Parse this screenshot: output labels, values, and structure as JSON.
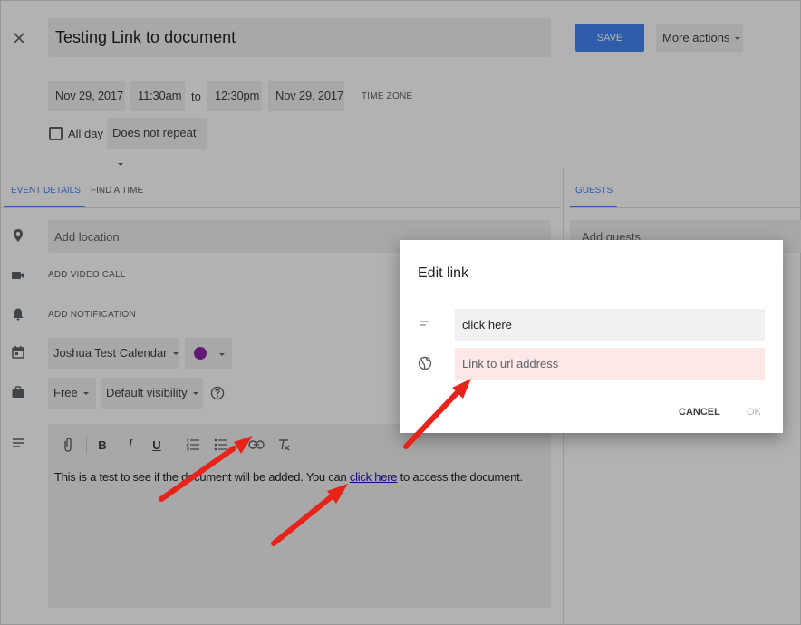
{
  "header": {
    "title": "Testing Link to document",
    "save_label": "SAVE",
    "more_actions_label": "More actions"
  },
  "schedule": {
    "start_date": "Nov 29, 2017",
    "start_time": "11:30am",
    "to_label": "to",
    "end_time": "12:30pm",
    "end_date": "Nov 29, 2017",
    "time_zone_label": "TIME ZONE",
    "all_day_label": "All day",
    "repeat_value": "Does not repeat"
  },
  "tabs": {
    "event_details": "EVENT DETAILS",
    "find_a_time": "FIND A TIME",
    "guests": "GUESTS"
  },
  "details": {
    "location_placeholder": "Add location",
    "video_call_label": "ADD VIDEO CALL",
    "notification_label": "ADD NOTIFICATION",
    "calendar_value": "Joshua Test Calendar",
    "availability_value": "Free",
    "visibility_value": "Default visibility",
    "event_color": "#8e24aa"
  },
  "guests": {
    "add_guests_placeholder": "Add guests"
  },
  "editor": {
    "text_before": "This is a test to see if the document will be added. You can ",
    "link_text": "click here",
    "text_after": " to access the document."
  },
  "dialog": {
    "title": "Edit link",
    "text_value": "click here",
    "url_placeholder": "Link to url address",
    "cancel_label": "CANCEL",
    "ok_label": "OK"
  },
  "colors": {
    "accent": "#4285f4",
    "annotation_arrow": "#e8231a",
    "url_field_bg": "#fde7e7"
  }
}
